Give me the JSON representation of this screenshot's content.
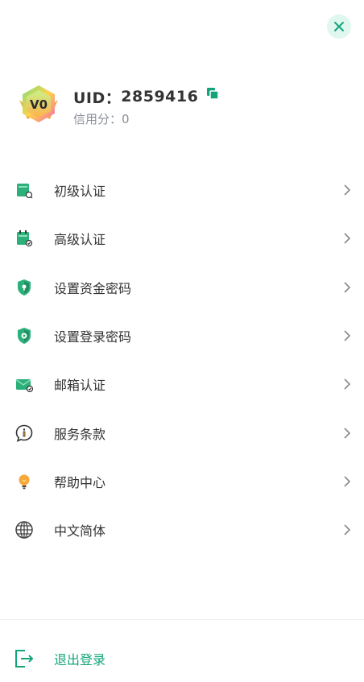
{
  "header": {
    "close_icon": "close-icon"
  },
  "profile": {
    "level_badge": "V0",
    "uid_label": "UID：",
    "uid_value": "2859416",
    "credit_label": "信用分：",
    "credit_value": "0",
    "copy_icon": "copy-icon"
  },
  "menu": {
    "items": [
      {
        "label": "初级认证",
        "icon": "id-card-icon"
      },
      {
        "label": "高级认证",
        "icon": "verified-document-icon"
      },
      {
        "label": "设置资金密码",
        "icon": "shield-lock-icon"
      },
      {
        "label": "设置登录密码",
        "icon": "shield-key-icon"
      },
      {
        "label": "邮箱认证",
        "icon": "mail-verify-icon"
      },
      {
        "label": "服务条款",
        "icon": "info-bubble-icon"
      },
      {
        "label": "帮助中心",
        "icon": "lightbulb-icon"
      },
      {
        "label": "中文简体",
        "icon": "globe-icon"
      }
    ]
  },
  "footer": {
    "logout_label": "退出登录",
    "logout_icon": "logout-icon"
  },
  "colors": {
    "accent": "#13a579",
    "close_bg": "#dff7ef",
    "muted_text": "#8a8f99"
  }
}
